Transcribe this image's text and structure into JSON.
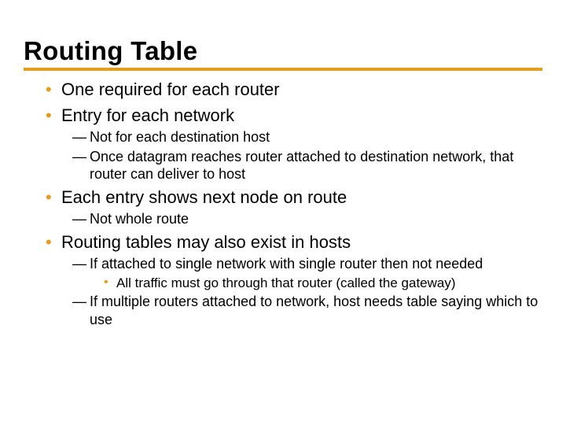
{
  "title": "Routing Table",
  "bullets": {
    "b1": "One required for each router",
    "b2": "Entry for each network",
    "b2_1": "Not for each destination host",
    "b2_2": "Once datagram reaches router attached to destination network, that router can deliver to host",
    "b3": "Each entry shows next node on route",
    "b3_1": "Not whole route",
    "b4": "Routing tables may also exist in hosts",
    "b4_1": "If attached to single network with single router then not needed",
    "b4_1_1": "All traffic must go through that router (called the gateway)",
    "b4_2": "If multiple routers attached to network, host needs table saying which to use"
  },
  "colors": {
    "accent": "#e69b1a"
  }
}
